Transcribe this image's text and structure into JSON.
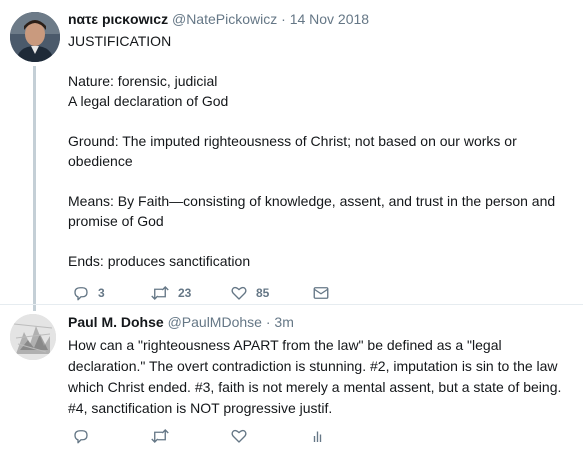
{
  "tweet1": {
    "display_name": "nατε pιcκowιcz",
    "handle": "@NatePickowicz",
    "separator": "·",
    "time": "14 Nov 2018",
    "lines": [
      "JUSTIFICATION",
      "",
      "Nature: forensic, judicial",
      "A legal declaration of God",
      "",
      "Ground: The imputed righteousness of Christ; not based on our works or obedience",
      "",
      "Means: By Faith—consisting of knowledge, assent, and trust in the person and promise of God",
      "",
      "Ends: produces sanctification"
    ],
    "actions": {
      "reply_icon": "reply-icon",
      "reply_count": "3",
      "retweet_icon": "retweet-icon",
      "retweet_count": "23",
      "like_icon": "like-icon",
      "like_count": "85",
      "message_icon": "direct-message-icon"
    }
  },
  "tweet2": {
    "display_name": "Paul M. Dohse",
    "handle": "@PaulMDohse",
    "separator": "·",
    "time": "3m",
    "text": "How can a \"righteousness APART from the law\" be defined as a \"legal declaration.\" The overt contradiction is stunning. #2, imputation is sin to the law which Christ ended. #3, faith is not merely a mental assent, but a state of being. #4, sanctification is NOT progressive justif.",
    "actions": {
      "reply_icon": "reply-icon",
      "retweet_icon": "retweet-icon",
      "like_icon": "like-icon",
      "analytics_icon": "analytics-icon"
    }
  },
  "colors": {
    "text": "#14171a",
    "secondary": "#657786",
    "thread_line": "#c4cfd6",
    "divider": "#e6ecf0"
  }
}
